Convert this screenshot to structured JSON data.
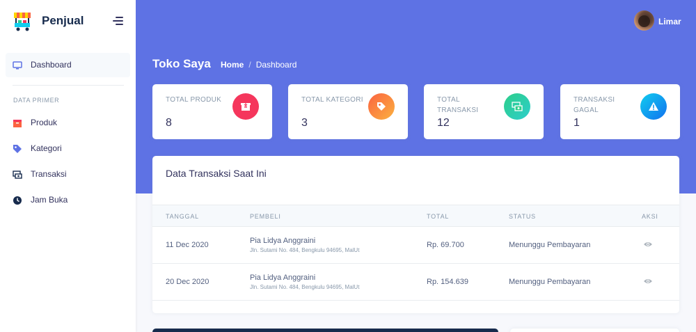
{
  "brand": {
    "name": "Penjual",
    "logo_icon": "market-stall-icon"
  },
  "sidebar": {
    "active_item": {
      "label": "Dashboard",
      "icon": "monitor-icon"
    },
    "section_heading": "DATA PRIMER",
    "items": [
      {
        "label": "Produk",
        "icon": "box-icon",
        "color": "#fb6340"
      },
      {
        "label": "Kategori",
        "icon": "tag-icon",
        "color": "#5e72e4"
      },
      {
        "label": "Transaksi",
        "icon": "money-transfer-icon",
        "color": "#172b4d"
      },
      {
        "label": "Jam Buka",
        "icon": "clock-icon",
        "color": "#172b4d"
      }
    ]
  },
  "header": {
    "user_name": "Limar",
    "page_title": "Toko Saya",
    "breadcrumb": {
      "home": "Home",
      "separator": "/",
      "current": "Dashboard"
    }
  },
  "stats": [
    {
      "title": "TOTAL PRODUK",
      "value": "8",
      "icon": "archive-icon",
      "color": "#f5365c"
    },
    {
      "title": "TOTAL KATEGORI",
      "value": "3",
      "icon": "tag-icon",
      "color": "#fb6340"
    },
    {
      "title": "TOTAL TRANSAKSI",
      "value": "12",
      "icon": "money-icon",
      "color": "#2dce89"
    },
    {
      "title": "TRANSAKSI GAGAL",
      "value": "1",
      "icon": "warning-icon",
      "color": "#11cdef"
    }
  ],
  "transactions": {
    "title": "Data Transaksi Saat Ini",
    "columns": [
      "TANGGAL",
      "PEMBELI",
      "TOTAL",
      "STATUS",
      "AKSI"
    ],
    "rows": [
      {
        "date": "11 Dec 2020",
        "buyer": "Pia Lidya Anggraini",
        "address": "Jln. Sutami No. 484, Bengkulu 94695, MalUt",
        "total": "Rp. 69.700",
        "status": "Menunggu Pembayaran",
        "action_icon": "eye-icon"
      },
      {
        "date": "20 Dec 2020",
        "buyer": "Pia Lidya Anggraini",
        "address": "Jln. Sutami No. 484, Bengkulu 94695, MalUt",
        "total": "Rp. 154.639",
        "status": "Menunggu Pembayaran",
        "action_icon": "eye-icon"
      }
    ]
  },
  "colors": {
    "primary": "#5e72e4",
    "text_dark": "#32325d",
    "muted": "#8898aa"
  }
}
